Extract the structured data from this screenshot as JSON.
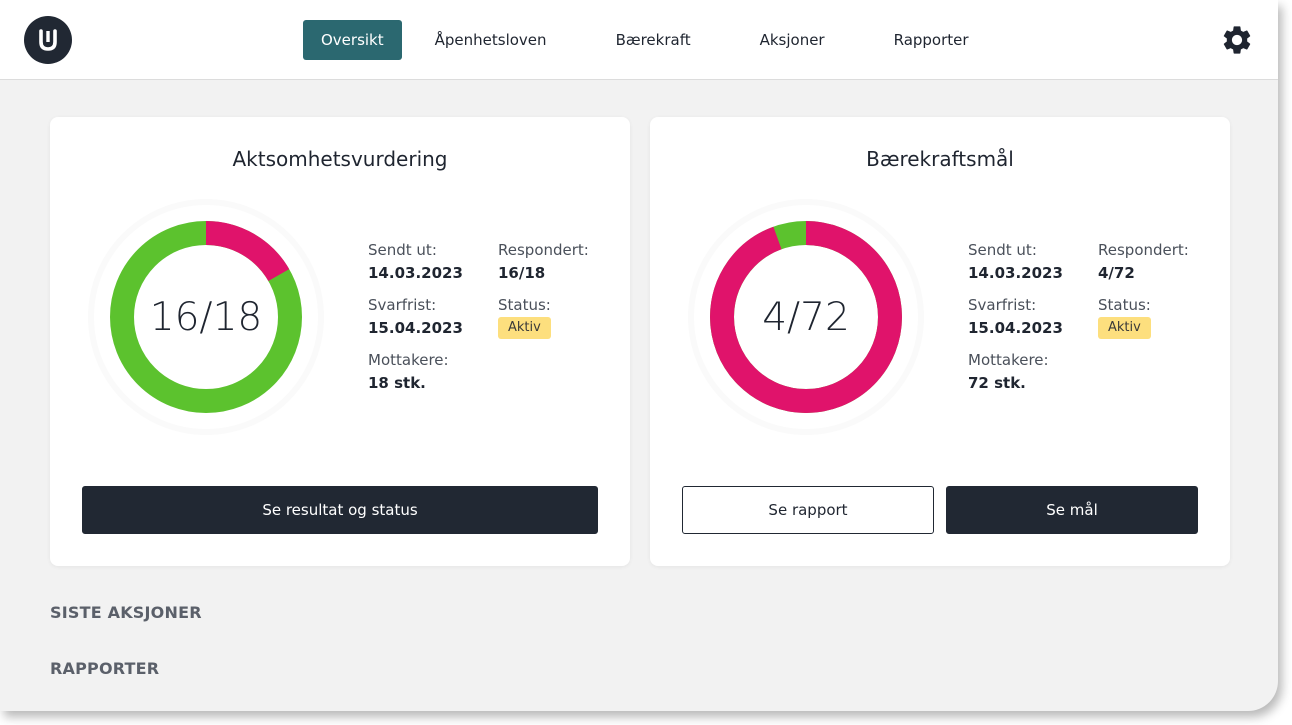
{
  "nav": {
    "items": [
      "Oversikt",
      "Åpenhetsloven",
      "Bærekraft",
      "Aksjoner",
      "Rapporter"
    ],
    "active": "Oversikt",
    "settings_icon": "gear-icon",
    "logo_icon": "u-logo-icon"
  },
  "colors": {
    "accent": "#2b6870",
    "dark": "#212833",
    "green": "#5cc22e",
    "pink": "#e0136b",
    "badge": "#fddf7e"
  },
  "cards": [
    {
      "title": "Aktsomhetsvurdering",
      "donut_label": "16/18",
      "responded_fraction": 0.8333,
      "sent_label": "Sendt ut:",
      "sent_value": "14.03.2023",
      "deadline_label": "Svarfrist:",
      "deadline_value": "15.04.2023",
      "recipients_label": "Mottakere:",
      "recipients_value": "18 stk.",
      "responded_label": "Respondert:",
      "responded_value": "16/18",
      "status_label": "Status:",
      "status_value": "Aktiv",
      "primary_button": "Se resultat og status"
    },
    {
      "title": "Bærekraftsmål",
      "donut_label": "4/72",
      "responded_fraction": 0.0556,
      "sent_label": "Sendt ut:",
      "sent_value": "14.03.2023",
      "deadline_label": "Svarfrist:",
      "deadline_value": "15.04.2023",
      "recipients_label": "Mottakere:",
      "recipients_value": "72 stk.",
      "responded_label": "Respondert:",
      "responded_value": "4/72",
      "status_label": "Status:",
      "status_value": "Aktiv",
      "secondary_button": "Se rapport",
      "primary_button": "Se mål"
    }
  ],
  "sections": {
    "recent_actions": "SISTE AKSJONER",
    "reports": "RAPPORTER"
  }
}
